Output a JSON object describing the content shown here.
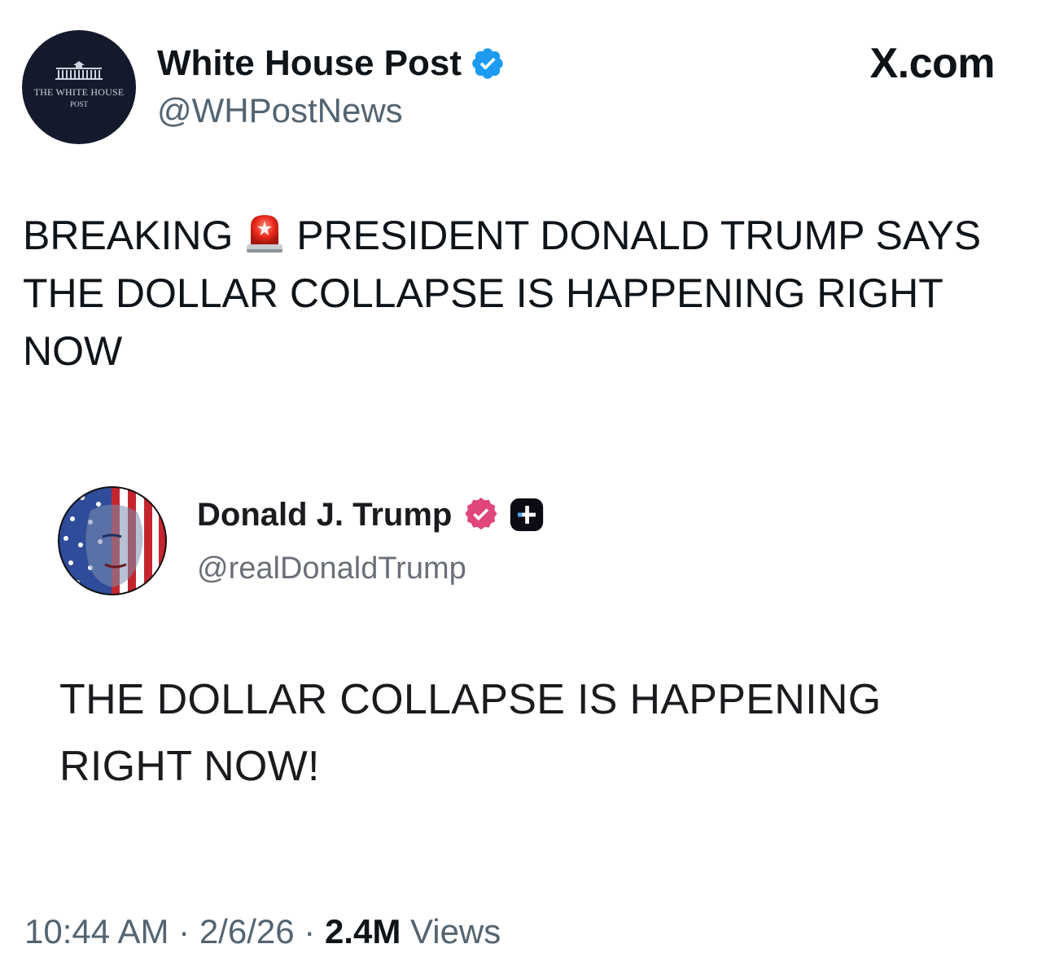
{
  "header": {
    "display_name": "White House Post",
    "handle": "@WHPostNews",
    "site_label": "X.com",
    "avatar_text_line1": "THE WHITE HOUSE",
    "avatar_text_line2": "POST",
    "verified_badge_color": "#1d9bf0"
  },
  "tweet": {
    "text_before_icon": "BREAKING",
    "icon": "police-siren-icon",
    "text_after_icon": "PRESIDENT DONALD TRUMP SAYS THE DOLLAR COLLAPSE IS HAPPENING RIGHT NOW"
  },
  "embedded_post": {
    "display_name": "Donald J. Trump",
    "handle": "@realDonaldTrump",
    "text": "THE DOLLAR COLLAPSE IS HAPPENING RIGHT NOW!",
    "verified_badge_color": "#e0457b",
    "plus_badge_icon": "plus-badge-icon"
  },
  "meta": {
    "time": "10:44 AM",
    "separator": "·",
    "date": "2/6/26",
    "views_count": "2.4M",
    "views_label": "Views"
  }
}
